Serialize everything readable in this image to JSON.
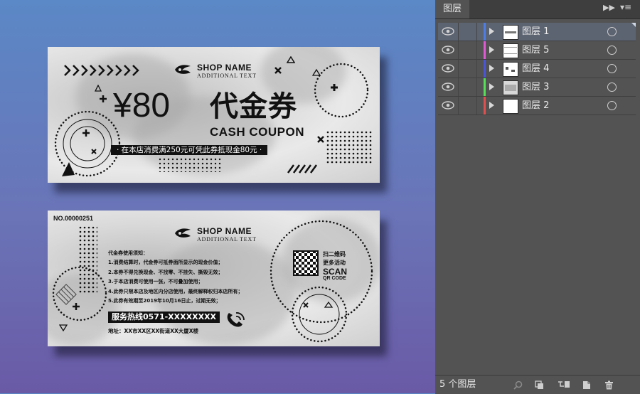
{
  "front": {
    "shop_name": "SHOP NAME",
    "additional_text": "ADDITIONAL TEXT",
    "amount": "¥80",
    "title_cn": "代金券",
    "title_en": "CASH COUPON",
    "band_text": "· 在本店消费满250元可凭此券抵现金80元 ·"
  },
  "back": {
    "serial": "NO.00000251",
    "shop_name": "SHOP NAME",
    "additional_text": "ADDITIONAL TEXT",
    "rules_title": "代金券使用须知：",
    "rules": [
      "1.消费结算时，代金券可抵券面所显示的现金价值；",
      "2.本券不得兑换现金、不找零、不挂失、撕毁无效；",
      "3.于本店消费可使用一张，不可叠加使用；",
      "4.此券只限本店及地区内分店使用，最终解释权归本店所有；",
      "5.此券有效期至2019年10月16日止，过期无效；"
    ],
    "hotline": "服务热线0571-XXXXXXXX",
    "address": "地址：XX市XX区XX街道XX大厦X楼",
    "scan_cn_1": "扫二维码",
    "scan_cn_2": "更多活动",
    "scan": "SCAN",
    "qr_code": "QR CODE"
  },
  "layers_panel": {
    "tab": "图层",
    "count_label": "5 个图层",
    "layers": [
      {
        "name": "图层 1",
        "color": "#4f7de6",
        "selected": true
      },
      {
        "name": "图层 5",
        "color": "#e05ad6",
        "selected": false
      },
      {
        "name": "图层 4",
        "color": "#4b56d6",
        "selected": false
      },
      {
        "name": "图层 3",
        "color": "#55e055",
        "selected": false
      },
      {
        "name": "图层 2",
        "color": "#e05050",
        "selected": false
      }
    ]
  }
}
